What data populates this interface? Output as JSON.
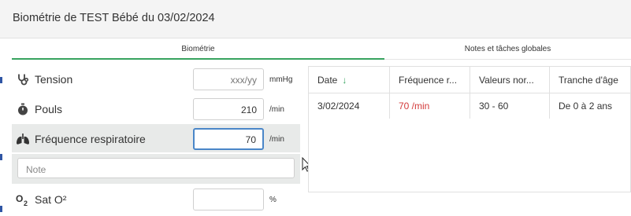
{
  "header": {
    "title": "Biométrie de TEST Bébé du 03/02/2024"
  },
  "tabs": [
    {
      "label": "Biométrie",
      "active": true
    },
    {
      "label": "Notes et tâches globales",
      "active": false
    }
  ],
  "fields": [
    {
      "icon": "stethoscope-icon",
      "label": "Tension",
      "value": "",
      "placeholder": "xxx/yy",
      "unit": "mmHg"
    },
    {
      "icon": "stopwatch-icon",
      "label": "Pouls",
      "value": "210",
      "placeholder": "",
      "unit": "/min"
    },
    {
      "icon": "lungs-icon",
      "label": "Fréquence respiratoire",
      "value": "70",
      "placeholder": "",
      "unit": "/min"
    },
    {
      "icon": "o2-icon",
      "label": "Sat O²",
      "value": "",
      "placeholder": "",
      "unit": "%"
    }
  ],
  "note": {
    "placeholder": "Note"
  },
  "table": {
    "headers": [
      "Date",
      "Fréquence r...",
      "Valeurs nor...",
      "Tranche d'âge"
    ],
    "sort_icon": "↓",
    "rows": [
      [
        "3/02/2024",
        "70 /min",
        "30 - 60",
        "De 0 à 2 ans"
      ]
    ]
  },
  "colors": {
    "accent": "#37a35f",
    "alert": "#d33a3a",
    "focus": "#4a86c8"
  }
}
